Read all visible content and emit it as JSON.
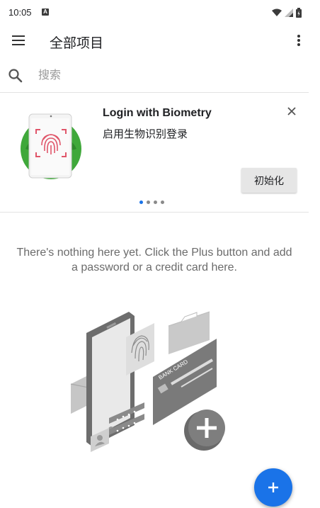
{
  "status_bar": {
    "time": "10:05",
    "notification_glyph": "A"
  },
  "app_bar": {
    "title": "全部项目"
  },
  "search": {
    "placeholder": "搜索",
    "value": ""
  },
  "promo_card": {
    "title": "Login with Biometry",
    "subtitle": "启用生物识别登录",
    "button_label": "初始化",
    "page_count": 4,
    "active_page": 0
  },
  "empty_state": {
    "message": "There's nothing here yet. Click the Plus button and add a password or a credit card here.",
    "card_label": "BANK CARD"
  },
  "colors": {
    "accent": "#1a73e8",
    "promo_green": "#3fa83a",
    "fingerprint_red": "#e0566a"
  },
  "icons": {
    "menu": "menu-icon",
    "more": "more-vert-icon",
    "search": "search-icon",
    "close": "close-icon",
    "fab": "plus-icon"
  }
}
